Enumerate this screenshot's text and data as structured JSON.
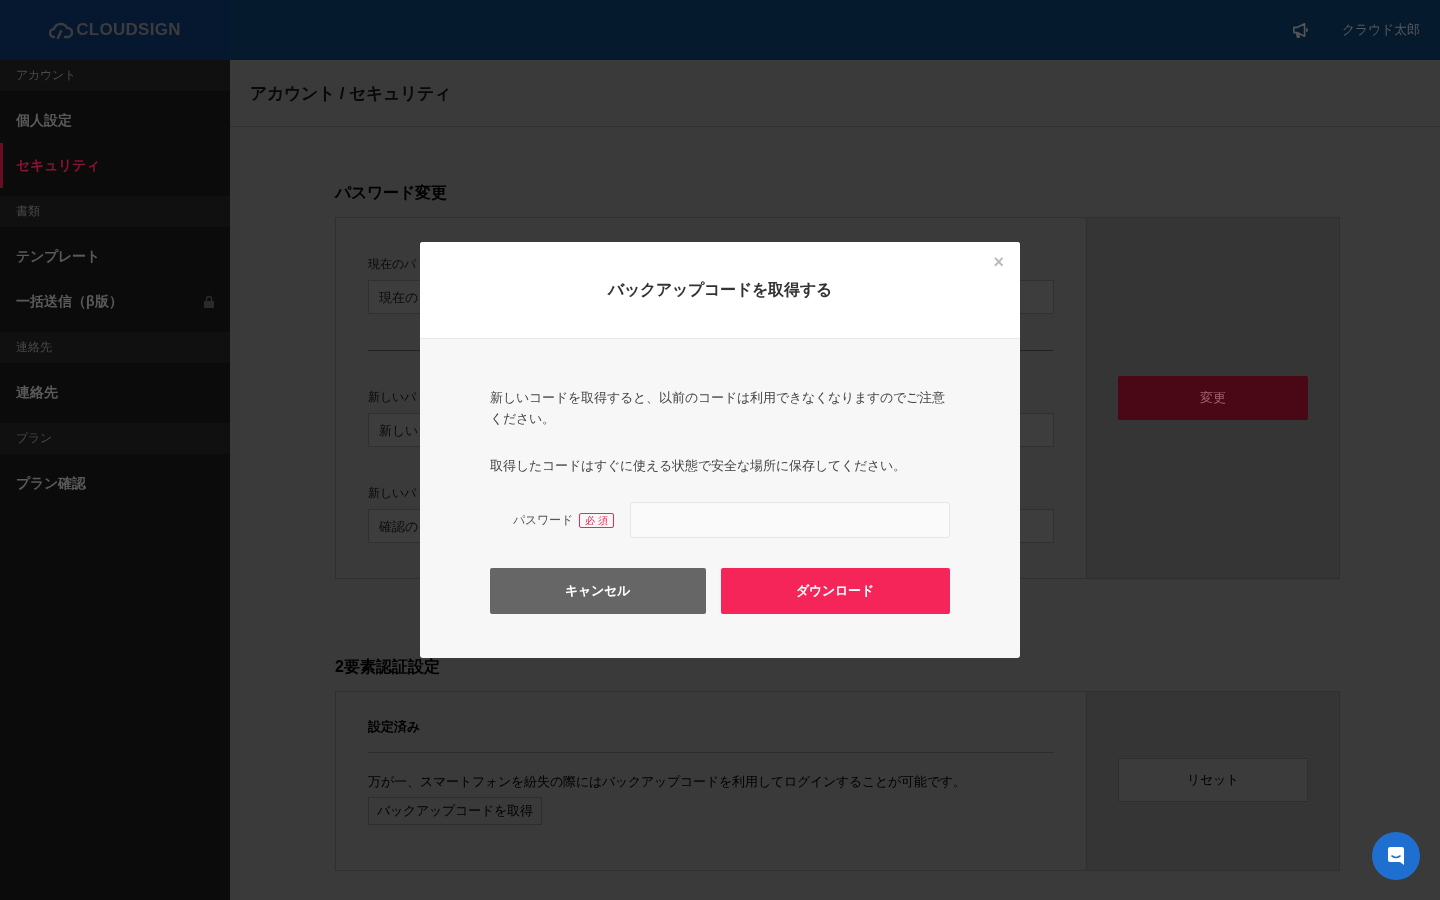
{
  "header": {
    "logo": "CLOUDSIGN",
    "user_name": "クラウド太郎"
  },
  "sidebar": {
    "sections": [
      {
        "heading": "アカウント",
        "items": [
          {
            "label": "個人設定",
            "selected": false,
            "locked": false
          },
          {
            "label": "セキュリティ",
            "selected": true,
            "locked": false
          }
        ]
      },
      {
        "heading": "書類",
        "items": [
          {
            "label": "テンプレート",
            "selected": false,
            "locked": false
          },
          {
            "label": "一括送信（β版）",
            "selected": false,
            "locked": true
          }
        ]
      },
      {
        "heading": "連絡先",
        "items": [
          {
            "label": "連絡先",
            "selected": false,
            "locked": false
          }
        ]
      },
      {
        "heading": "プラン",
        "items": [
          {
            "label": "プラン確認",
            "selected": false,
            "locked": false
          }
        ]
      }
    ]
  },
  "breadcrumb": "アカウント / セキュリティ",
  "password_section": {
    "title": "パスワード変更",
    "fields": [
      {
        "label": "現在のパ",
        "placeholder": "現在の"
      },
      {
        "label": "新しいパ",
        "placeholder": "新しい"
      },
      {
        "label": "新しいパ",
        "placeholder": "確認の"
      }
    ],
    "submit": "変更"
  },
  "two_factor_section": {
    "title": "2要素認証設定",
    "status": "設定済み",
    "description": "万が一、スマートフォンを紛失の際にはバックアップコードを利用してログインすることが可能です。",
    "backup_button": "バックアップコードを取得",
    "reset_button": "リセット"
  },
  "modal": {
    "title": "バックアップコードを取得する",
    "close": "×",
    "paragraphs": [
      "新しいコードを取得すると、以前のコードは利用できなくなりますのでご注意ください。",
      "取得したコードはすぐに使える状態で安全な場所に保存してください。"
    ],
    "password_label": "パスワード",
    "required_badge": "必 須",
    "cancel": "キャンセル",
    "download": "ダウンロード"
  }
}
